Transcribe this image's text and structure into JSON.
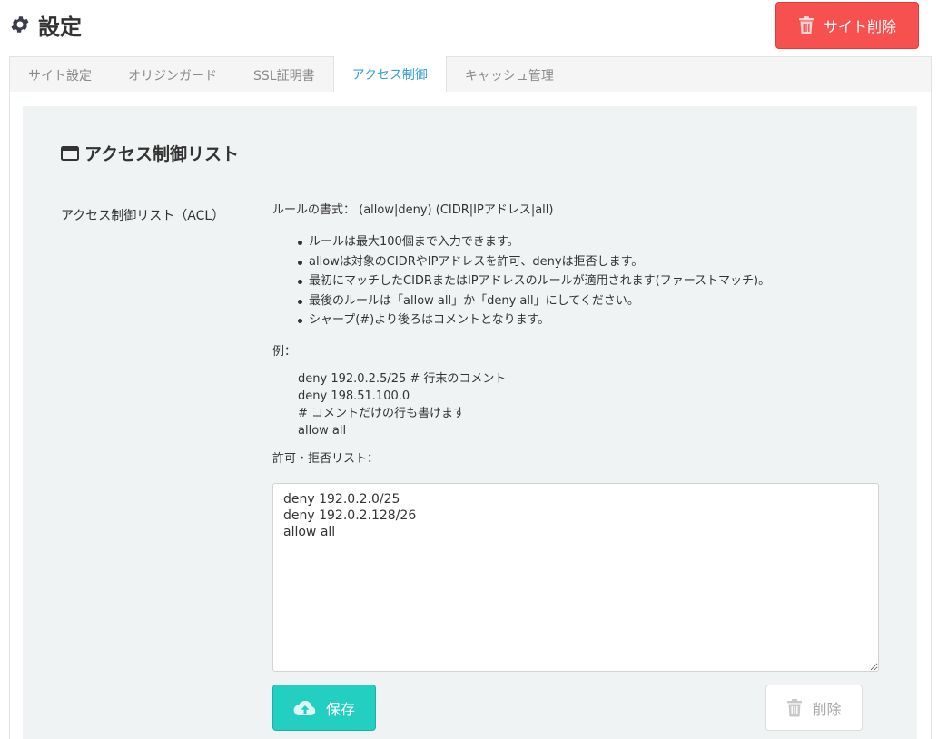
{
  "header": {
    "title": "設定",
    "title_icon": "gear-icon",
    "delete_site_label": "サイト削除"
  },
  "tabs": [
    {
      "label": "サイト設定",
      "active": false
    },
    {
      "label": "オリジンガード",
      "active": false
    },
    {
      "label": "SSL証明書",
      "active": false
    },
    {
      "label": "アクセス制御",
      "active": true
    },
    {
      "label": "キャッシュ管理",
      "active": false
    }
  ],
  "section": {
    "title": "アクセス制御リスト",
    "title_icon": "window-icon"
  },
  "acl": {
    "field_label": "アクセス制御リスト（ACL）",
    "rule_format": "ルールの書式： (allow|deny) (CIDR|IPアドレス|all)",
    "bullets": [
      "ルールは最大100個まで入力できます。",
      "allowは対象のCIDRやIPアドレスを許可、denyは拒否します。",
      "最初にマッチしたCIDRまたはIPアドレスのルールが適用されます(ファーストマッチ)。",
      "最後のルールは「allow all」か「deny all」にしてください。",
      "シャープ(#)より後ろはコメントとなります。"
    ],
    "example_label": "例：",
    "example_lines": [
      "deny 192.0.2.5/25 # 行末のコメント",
      "deny 198.51.100.0",
      "# コメントだけの行も書けます",
      "allow all"
    ],
    "list_label": "許可・拒否リスト：",
    "list_value": "deny 192.0.2.0/25\ndeny 192.0.2.128/26\nallow all"
  },
  "actions": {
    "save_label": "保存",
    "delete_label": "削除"
  },
  "colors": {
    "danger": "#f6504f",
    "accent_tab": "#3aa0d8",
    "save": "#22cfc0",
    "panel_bg": "#f0f3f3"
  }
}
